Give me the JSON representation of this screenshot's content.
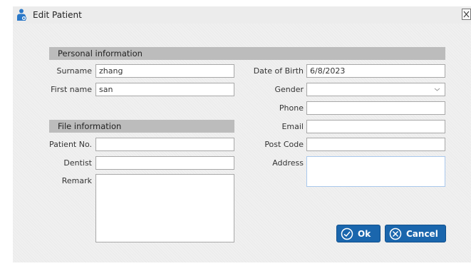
{
  "window": {
    "title": "Edit Patient",
    "icon": "patient-icon",
    "close_icon": "close-icon"
  },
  "personal": {
    "header": "Personal information",
    "surname": {
      "label": "Surname",
      "value": "zhang"
    },
    "first_name": {
      "label": "First name",
      "value": "san"
    },
    "date_of_birth": {
      "label": "Date of Birth",
      "value": "6/8/2023"
    },
    "gender": {
      "label": "Gender",
      "value": ""
    },
    "phone": {
      "label": "Phone",
      "value": ""
    },
    "email": {
      "label": "Email",
      "value": ""
    },
    "post_code": {
      "label": "Post Code",
      "value": ""
    },
    "address": {
      "label": "Address",
      "value": ""
    }
  },
  "file": {
    "header": "File information",
    "patient_no": {
      "label": "Patient No.",
      "value": ""
    },
    "dentist": {
      "label": "Dentist",
      "value": ""
    },
    "remark": {
      "label": "Remark",
      "value": ""
    }
  },
  "buttons": {
    "ok": {
      "label": "Ok",
      "icon": "check-circle-icon"
    },
    "cancel": {
      "label": "Cancel",
      "icon": "x-circle-icon"
    }
  },
  "colors": {
    "button_blue": "#1a66ad",
    "section_header": "#bcbcbc",
    "focused_border": "#a9c8ec"
  }
}
